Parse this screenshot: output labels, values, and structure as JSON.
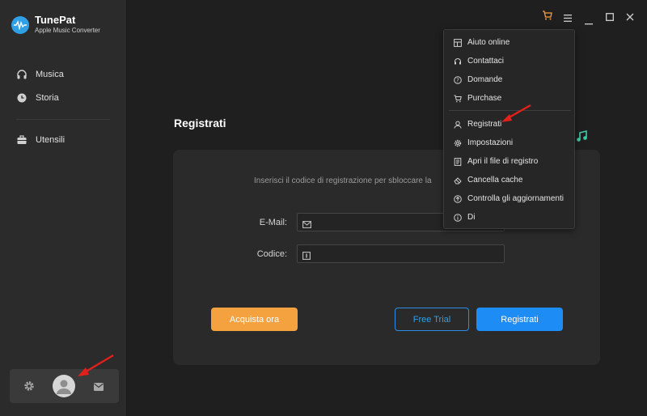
{
  "app": {
    "name": "TunePat",
    "subtitle": "Apple Music Converter"
  },
  "sidebar": {
    "items": [
      {
        "label": "Musica",
        "icon": "headphones-icon"
      },
      {
        "label": "Storia",
        "icon": "clock-icon"
      },
      {
        "label": "Utensili",
        "icon": "toolbox-icon"
      }
    ],
    "bottom": {
      "settings_icon": "gear-icon",
      "account_icon": "user-icon",
      "mail_icon": "mail-icon"
    }
  },
  "titlebar": {
    "cart_icon": "cart-icon",
    "menu_icon": "hamburger-icon",
    "minimize_icon": "minimize-icon",
    "maximize_icon": "maximize-icon",
    "close_icon": "close-icon"
  },
  "main": {
    "title": "Registrati",
    "prompt": "Inserisci il codice di registrazione per sbloccare la",
    "email_label": "E-Mail:",
    "email_value": "",
    "code_label": "Codice:",
    "code_value": "",
    "buy_button": "Acquista ora",
    "trial_button": "Free Trial",
    "register_button": "Registrati"
  },
  "menu": {
    "items": [
      {
        "label": "Aiuto online",
        "icon": "help-book-icon"
      },
      {
        "label": "Contattaci",
        "icon": "headset-icon"
      },
      {
        "label": "Domande",
        "icon": "question-icon"
      },
      {
        "label": "Purchase",
        "icon": "cart-icon"
      },
      {
        "label": "Registrati",
        "icon": "user-icon"
      },
      {
        "label": "Impostazioni",
        "icon": "gear-icon"
      },
      {
        "label": "Apri il file di registro",
        "icon": "log-file-icon"
      },
      {
        "label": "Cancella cache",
        "icon": "eraser-icon"
      },
      {
        "label": "Controlla gli aggiornamenti",
        "icon": "update-icon"
      },
      {
        "label": "Di",
        "icon": "info-icon"
      }
    ]
  },
  "colors": {
    "accent_blue": "#1e8cf5",
    "accent_orange": "#f4a140",
    "annotation_red": "#e0201b"
  }
}
